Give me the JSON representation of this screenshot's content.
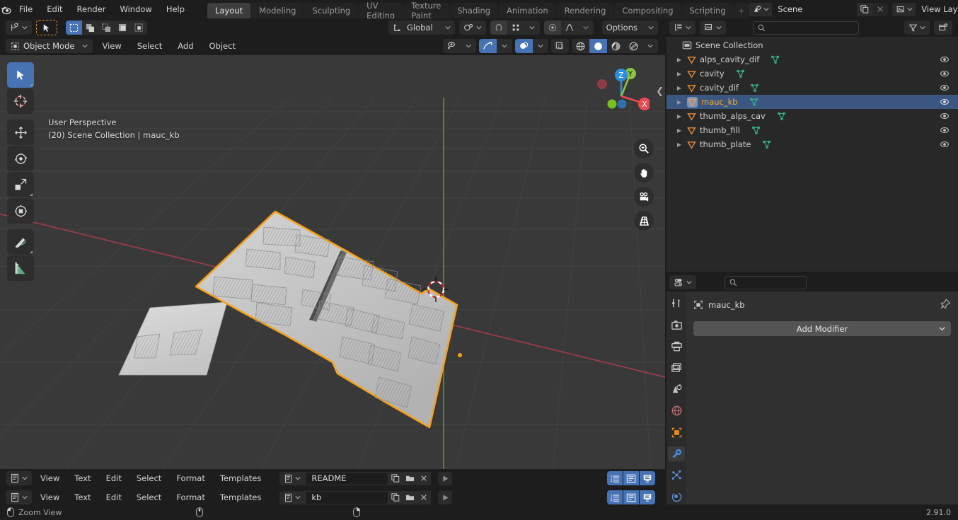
{
  "topbar": {
    "logo_icon": "blender-logo-icon",
    "menus": [
      "File",
      "Edit",
      "Render",
      "Window",
      "Help"
    ],
    "workspaces": [
      {
        "label": "Layout",
        "active": true
      },
      {
        "label": "Modeling",
        "active": false
      },
      {
        "label": "Sculpting",
        "active": false
      },
      {
        "label": "UV Editing",
        "active": false
      },
      {
        "label": "Texture Paint",
        "active": false
      },
      {
        "label": "Shading",
        "active": false
      },
      {
        "label": "Animation",
        "active": false
      },
      {
        "label": "Rendering",
        "active": false
      },
      {
        "label": "Compositing",
        "active": false
      },
      {
        "label": "Scripting",
        "active": false
      }
    ],
    "scene": {
      "icon": "scene-icon",
      "name": "Scene",
      "copy_icon": "new-scene-icon",
      "close_icon": "unlink-icon"
    },
    "view_layer": {
      "icon": "view-layer-icon",
      "name": "View Layer",
      "copy_icon": "new-view-layer-icon",
      "close_icon": "unlink-icon"
    }
  },
  "viewport": {
    "header": {
      "editor_type_icon": "editor-type-3dview-icon",
      "select_mode_icon": "select-box-icon",
      "select_modes": [
        "select-new-icon",
        "select-extend-icon",
        "select-subtract-icon",
        "select-invert-icon",
        "select-intersect-icon"
      ],
      "transform_orientation": "Global",
      "orientation_icon": "orientation-icon",
      "snap_icon": "snap-magnet-icon",
      "snap_target_icon": "snap-increment-icon",
      "proportional_icon": "proportional-edit-icon",
      "falloff_icon": "proportional-falloff-icon",
      "options_label": "Options"
    },
    "header2": {
      "mode": "Object Mode",
      "mode_icon": "object-mode-icon",
      "menus": [
        "View",
        "Select",
        "Add",
        "Object"
      ],
      "visibility_icon": "object-visibility-icon",
      "gizmo_icon": "show-gizmo-icon",
      "overlays_icon": "show-overlays-icon",
      "xray_icon": "toggle-xray-icon",
      "shading_modes": [
        "shading-wireframe-icon",
        "shading-solid-icon",
        "shading-material-icon",
        "shading-rendered-icon"
      ],
      "shading_active_index": 1
    },
    "tools": [
      {
        "name": "tweak-select-box-tool",
        "icon": "select-box-icon",
        "active": true
      },
      {
        "name": "cursor-tool",
        "icon": "3d-cursor-icon",
        "active": false
      },
      {
        "name": "move-tool",
        "icon": "move-arrows-icon",
        "active": false
      },
      {
        "name": "rotate-tool",
        "icon": "rotate-icon",
        "active": false
      },
      {
        "name": "scale-tool",
        "icon": "scale-icon",
        "active": false
      },
      {
        "name": "transform-tool",
        "icon": "transform-icon",
        "active": false
      },
      {
        "name": "annotate-tool",
        "icon": "annotate-pencil-icon",
        "active": false
      },
      {
        "name": "measure-tool",
        "icon": "measure-ruler-icon",
        "active": false
      }
    ],
    "info_line1": "User Perspective",
    "info_line2": "(20) Scene Collection | mauc_kb",
    "gizmo": {
      "axes": [
        {
          "label": "X",
          "color": "#ec4a53"
        },
        {
          "label": "Y",
          "color": "#8bc63f"
        },
        {
          "label": "Z",
          "color": "#2c8ee0"
        }
      ]
    },
    "nav_buttons": [
      {
        "name": "zoom-view-button",
        "icon": "zoom-magnifier-icon"
      },
      {
        "name": "pan-view-button",
        "icon": "hand-icon"
      },
      {
        "name": "camera-view-button",
        "icon": "camera-icon"
      },
      {
        "name": "toggle-projection-button",
        "icon": "grid-perspective-icon"
      }
    ],
    "scene_objects": {
      "selected_outline_color": "#f5a11a",
      "model_color": "#c8c8c8",
      "description": "Split ergonomic keyboard plate with key cutouts, selected"
    }
  },
  "outliner": {
    "display_mode_icon": "outliner-display-mode-icon",
    "filter_id_icon": "filter-id-icon",
    "search_placeholder": "",
    "search_value": "",
    "search_icon": "search-icon",
    "filter_icon": "filter-funnel-icon",
    "new_collection_icon": "new-collection-icon",
    "root": {
      "label": "Scene Collection",
      "icon": "collection-icon"
    },
    "items": [
      {
        "label": "alps_cavity_dif",
        "icon": "object-mesh-icon",
        "data_icon": "mesh-data-icon",
        "selected": false,
        "visible": true
      },
      {
        "label": "cavity",
        "icon": "object-mesh-icon",
        "data_icon": "mesh-data-icon",
        "selected": false,
        "visible": true
      },
      {
        "label": "cavity_dif",
        "icon": "object-mesh-icon",
        "data_icon": "mesh-data-icon",
        "selected": false,
        "visible": true
      },
      {
        "label": "mauc_kb",
        "icon": "object-mesh-icon",
        "data_icon": "mesh-data-icon",
        "selected": true,
        "visible": true
      },
      {
        "label": "thumb_alps_cav",
        "icon": "object-mesh-icon",
        "data_icon": "mesh-data-icon",
        "selected": false,
        "visible": true
      },
      {
        "label": "thumb_fill",
        "icon": "object-mesh-icon",
        "data_icon": "mesh-data-icon",
        "selected": false,
        "visible": true
      },
      {
        "label": "thumb_plate",
        "icon": "object-mesh-icon",
        "data_icon": "mesh-data-icon",
        "selected": false,
        "visible": true
      }
    ]
  },
  "properties": {
    "editor_icon": "properties-editor-icon",
    "search_value": "",
    "search_icon": "search-icon",
    "tabs": [
      {
        "name": "tool-tab",
        "icon": "tool-screwdriver-wrench-icon",
        "active": false
      },
      {
        "name": "render-tab",
        "icon": "render-camera-back-icon",
        "active": false
      },
      {
        "name": "output-tab",
        "icon": "output-printer-icon",
        "active": false
      },
      {
        "name": "view-layer-tab",
        "icon": "view-layer-images-icon",
        "active": false
      },
      {
        "name": "scene-tab",
        "icon": "scene-cone-sphere-icon",
        "active": false
      },
      {
        "name": "world-tab",
        "icon": "world-globe-icon",
        "active": false
      },
      {
        "name": "object-tab",
        "icon": "object-orange-square-icon",
        "active": false
      },
      {
        "name": "modifier-tab",
        "icon": "modifier-wrench-icon",
        "active": true
      },
      {
        "name": "particles-tab",
        "icon": "particles-icon",
        "active": false
      },
      {
        "name": "physics-tab",
        "icon": "physics-orbit-icon",
        "active": false
      }
    ],
    "breadcrumb": {
      "object_icon": "object-data-icon",
      "object_name": "mauc_kb",
      "pin_icon": "pin-icon"
    },
    "add_modifier_label": "Add Modifier",
    "add_modifier_chevron": "chevron-down-icon"
  },
  "text_editors": [
    {
      "editor_icon": "text-editor-icon",
      "menus": [
        "View",
        "Text",
        "Edit",
        "Select",
        "Format",
        "Templates"
      ],
      "datablock_icon": "text-datablock-icon",
      "filename": "README",
      "copy_icon": "new-text-icon",
      "open_icon": "open-folder-icon",
      "close_icon": "unlink-text-icon",
      "run_icon": "run-script-icon",
      "toggles": [
        {
          "name": "line-numbers-toggle",
          "icon": "line-numbers-icon",
          "on": true
        },
        {
          "name": "word-wrap-toggle",
          "icon": "word-wrap-icon",
          "on": true
        },
        {
          "name": "syntax-highlight-toggle",
          "icon": "syntax-highlight-icon",
          "on": true
        }
      ]
    },
    {
      "editor_icon": "text-editor-icon",
      "menus": [
        "View",
        "Text",
        "Edit",
        "Select",
        "Format",
        "Templates"
      ],
      "datablock_icon": "text-datablock-icon",
      "filename": "kb",
      "copy_icon": "new-text-icon",
      "open_icon": "open-folder-icon",
      "close_icon": "unlink-text-icon",
      "run_icon": "run-script-icon",
      "toggles": [
        {
          "name": "line-numbers-toggle",
          "icon": "line-numbers-icon",
          "on": true
        },
        {
          "name": "word-wrap-toggle",
          "icon": "word-wrap-icon",
          "on": true
        },
        {
          "name": "syntax-highlight-toggle",
          "icon": "syntax-highlight-icon",
          "on": true
        }
      ]
    }
  ],
  "statusbar": {
    "mouse_left_icon": "mouse-left-button-icon",
    "left_label": "Zoom View",
    "mouse_middle_icon": "mouse-middle-button-icon",
    "mouse_right_icon": "mouse-right-button-icon",
    "version": "2.91.0"
  },
  "colors": {
    "accent_blue": "#4772b3",
    "selected_orange": "#ffaf29",
    "outline_orange": "#f5a11a",
    "bg_dark": "#1d1d1d",
    "bg_panel": "#282828",
    "viewport_bg": "#393939"
  }
}
